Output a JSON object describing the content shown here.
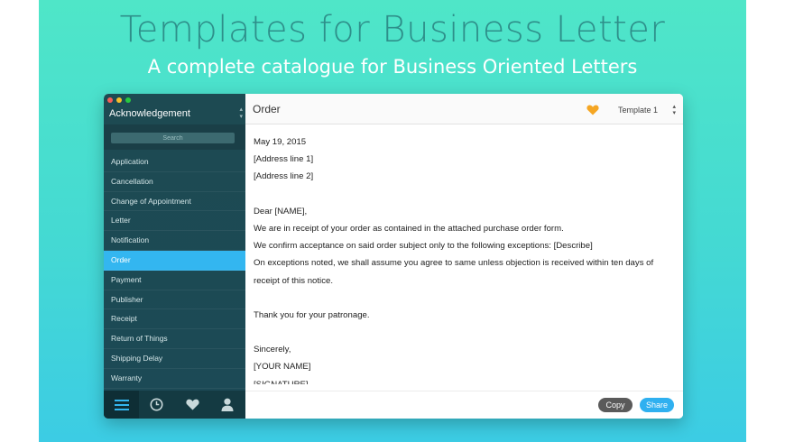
{
  "hero": {
    "title": "Templates for Business Letter",
    "subtitle": "A complete catalogue for Business Oriented Letters"
  },
  "sidebar": {
    "category": "Acknowledgement",
    "search_placeholder": "Search",
    "items": [
      {
        "label": "Application"
      },
      {
        "label": "Cancellation"
      },
      {
        "label": "Change of Appointment"
      },
      {
        "label": "Letter"
      },
      {
        "label": "Notification"
      },
      {
        "label": "Order"
      },
      {
        "label": "Payment"
      },
      {
        "label": "Publisher"
      },
      {
        "label": "Receipt"
      },
      {
        "label": "Return of Things"
      },
      {
        "label": "Shipping Delay"
      },
      {
        "label": "Warranty"
      }
    ],
    "active_item": "Order",
    "tabs": [
      {
        "icon": "list-icon"
      },
      {
        "icon": "clock-icon"
      },
      {
        "icon": "heart-icon"
      },
      {
        "icon": "user-icon"
      }
    ]
  },
  "document": {
    "title": "Order",
    "template": "Template 1",
    "lines": {
      "date": "May 19, 2015",
      "address1": "[Address line 1]",
      "address2": "[Address line 2]",
      "greeting": "Dear [NAME],",
      "p1": "We are in receipt of your order as contained in the attached purchase order form.",
      "p2": "We confirm acceptance on said order subject only to the following exceptions: [Describe]",
      "p3a": "On exceptions noted, we shall assume you agree to same unless objection is received within ten days of",
      "p3b": "receipt of this notice.",
      "thanks": "Thank you for your patronage.",
      "closing": "Sincerely,",
      "name": "[YOUR NAME]",
      "signature": "[SIGNATURE]"
    }
  },
  "actions": {
    "copy": "Copy",
    "share": "Share"
  },
  "colors": {
    "accent": "#33b6f0",
    "sidebar_bg": "#1d4a52",
    "favorite": "#f5a623"
  }
}
